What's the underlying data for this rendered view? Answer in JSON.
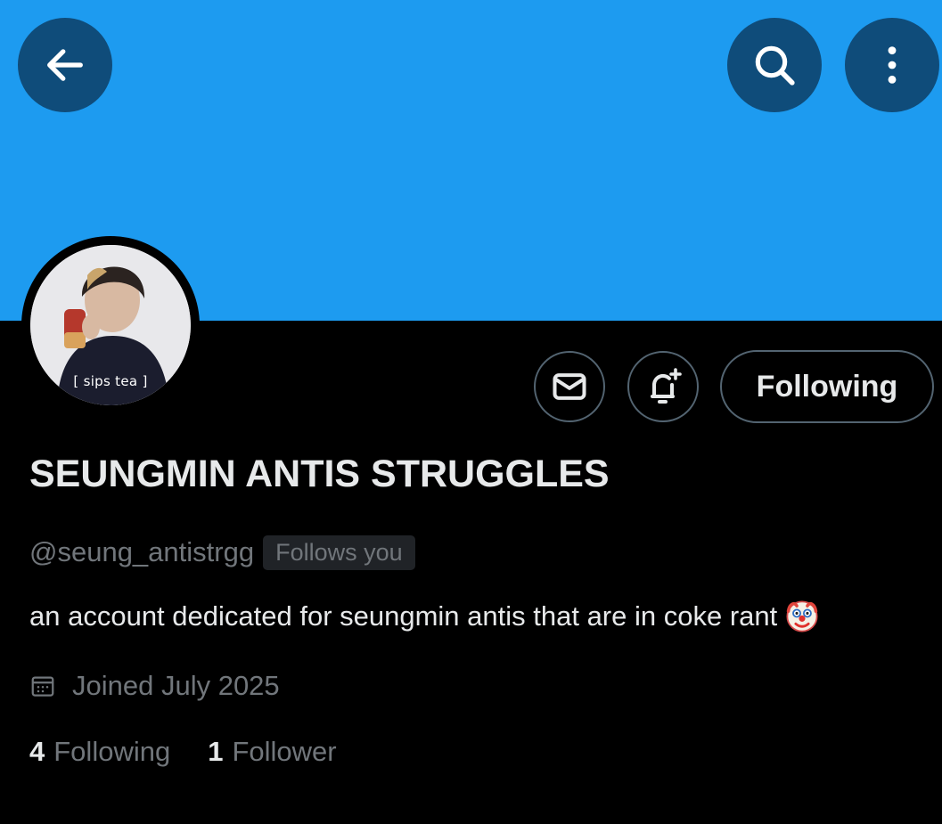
{
  "header": {
    "back_icon": "arrow-left-icon",
    "search_icon": "search-icon",
    "more_icon": "more-vertical-icon",
    "banner_color": "#1d9bf0",
    "button_color": "#0f4c7a"
  },
  "profile": {
    "avatar_caption": "[ sips tea ]",
    "display_name": "SEUNGMIN ANTIS STRUGGLES",
    "handle": "@seung_antistrgg",
    "follows_you": "Follows you",
    "bio": "an account dedicated for seungmin antis that are in coke rant",
    "bio_emoji": "clown-face-emoji",
    "joined": "Joined July 2025",
    "following_count": "4",
    "following_label": "Following",
    "followers_count": "1",
    "followers_label": "Follower"
  },
  "actions": {
    "message_icon": "mail-icon",
    "notify_icon": "bell-plus-icon",
    "following_button": "Following"
  }
}
